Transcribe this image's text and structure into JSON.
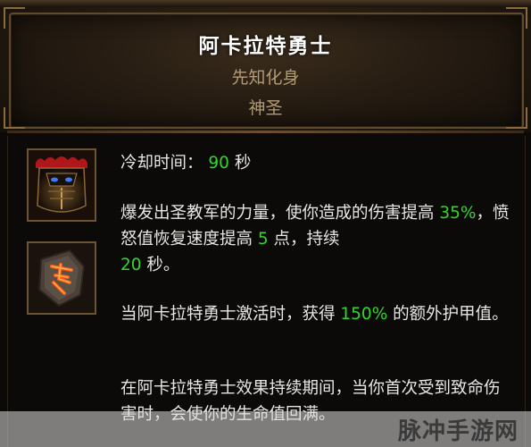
{
  "skill": {
    "name": "阿卡拉特勇士",
    "class": "先知化身",
    "type": "神圣"
  },
  "cooldown": {
    "label": "冷却时间：",
    "value": "90",
    "unit": "秒"
  },
  "description": {
    "p1": {
      "a": "爆发出圣教军的力量，使你造成的伤害提高 ",
      "v1": "35%",
      "b": "，愤怒值恢复速度提高 ",
      "v2": "5",
      "c": " 点，持续",
      "v3": "20",
      "d": " 秒。"
    },
    "p2": {
      "a": "当阿卡拉特勇士激活时，获得 ",
      "v1": "150%",
      "b": " 的额外护甲值。"
    },
    "p3": {
      "a": "在阿卡拉特勇士效果持续期间，当你首次受到致命伤害时，会使你的生命值回满。"
    }
  },
  "icons": {
    "skill_icon": "helmet-icon",
    "rune_icon": "rune-icon"
  },
  "colors": {
    "highlight": "#2fd82a",
    "title": "#ffffff",
    "subtitle": "#b39b74"
  },
  "watermark": "脉冲手游网"
}
